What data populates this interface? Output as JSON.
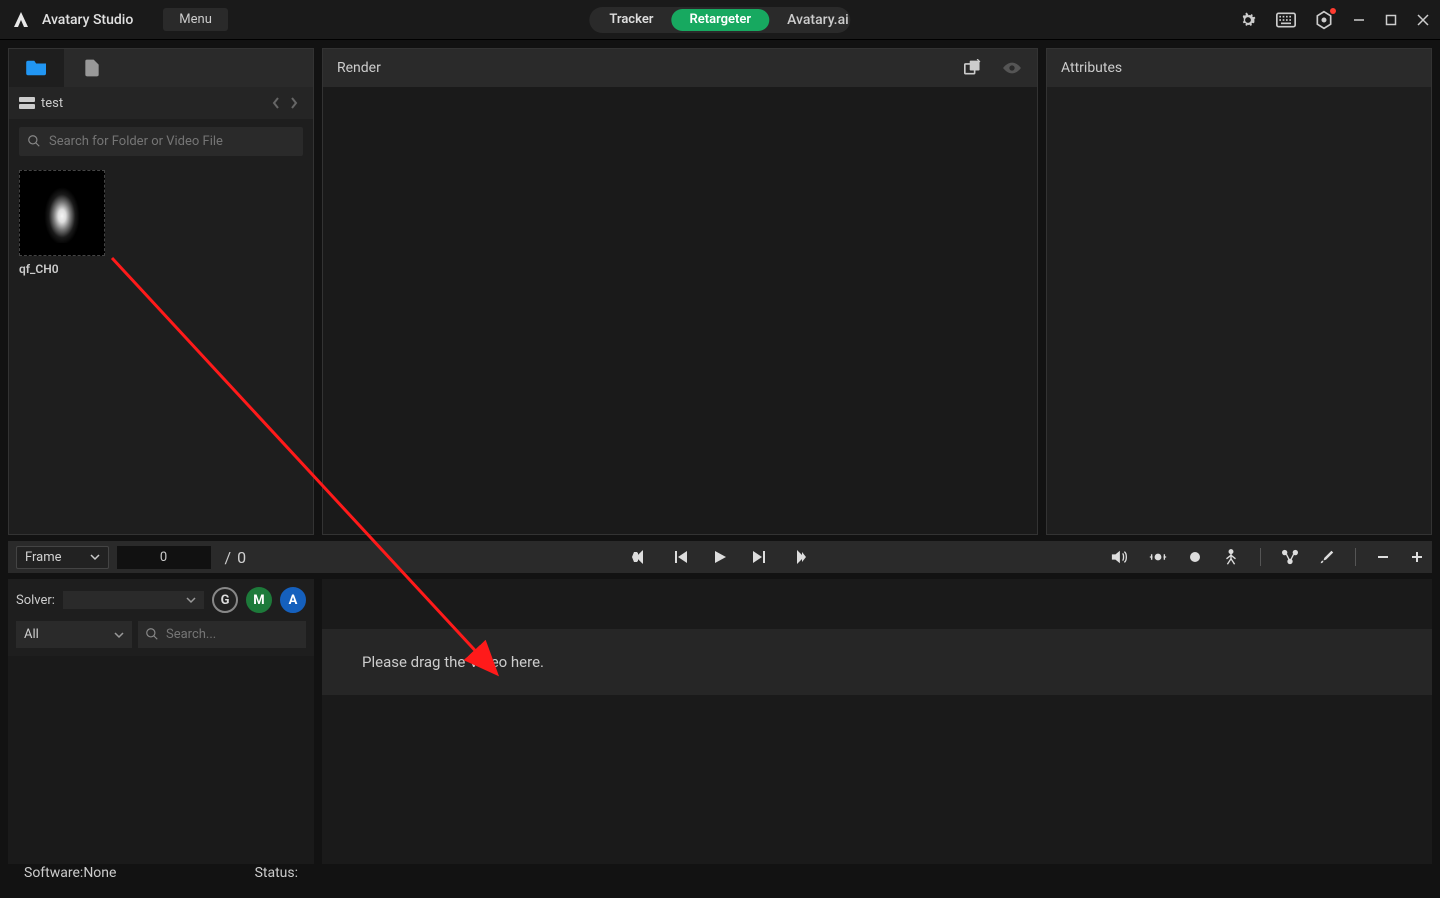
{
  "app_title": "Avatary Studio",
  "menu_label": "Menu",
  "nav": {
    "tracker": "Tracker",
    "retargeter": "Retargeter",
    "ai_link": "Avatary.ai"
  },
  "sidebar": {
    "breadcrumb": "test",
    "search_placeholder": "Search for Folder or Video File",
    "asset_label": "qf_CH0"
  },
  "render": {
    "title": "Render"
  },
  "attributes": {
    "title": "Attributes"
  },
  "timeline": {
    "frame_label": "Frame",
    "frame_value": "0",
    "slash": "/",
    "total": "0"
  },
  "solver": {
    "label": "Solver:",
    "badge_g": "G",
    "badge_m": "M",
    "badge_a": "A",
    "filter_all": "All",
    "search_placeholder": "Search..."
  },
  "dropzone": {
    "text": "Please drag the Video here."
  },
  "status": {
    "software_label": "Software:",
    "software_value": "None",
    "status_label": "Status:"
  }
}
